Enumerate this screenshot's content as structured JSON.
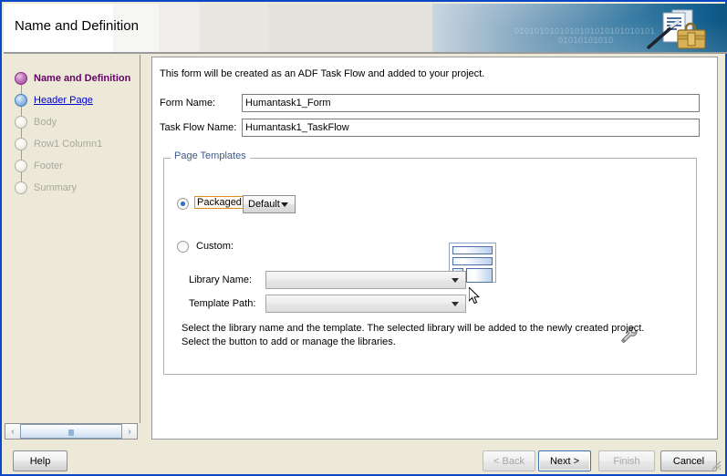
{
  "window": {
    "accent_border": "#0a48c8",
    "banner_title": "Name and Definition",
    "banner_binary_1": "0101010101010101010101010101",
    "banner_binary_2": "01010101010",
    "wizard_icon": "wizard-document-wand-briefcase-icon"
  },
  "sidebar": {
    "items": [
      {
        "label": "Name and Definition",
        "state": "active"
      },
      {
        "label": "Header Page",
        "state": "link"
      },
      {
        "label": "Body",
        "state": "disabled"
      },
      {
        "label": "Row1 Column1",
        "state": "disabled"
      },
      {
        "label": "Footer",
        "state": "disabled"
      },
      {
        "label": "Summary",
        "state": "disabled"
      }
    ],
    "scrollbar": {
      "left_arrow": "‹",
      "right_arrow": "›"
    }
  },
  "main": {
    "intro": "This form will be created as an ADF Task Flow and added to your project.",
    "fields": [
      {
        "label": "Form Name:",
        "value": "Humantask1_Form"
      },
      {
        "label": "Task Flow Name:",
        "value": "Humantask1_TaskFlow"
      }
    ],
    "group": {
      "title": "Page Templates",
      "packaged": {
        "label": "Packaged:",
        "selected": true,
        "focus_color": "#e08a1e",
        "combo_value": "Default",
        "preview_icon": "page-template-preview-icon"
      },
      "custom": {
        "label": "Custom:",
        "selected": false
      },
      "library_name": {
        "label": "Library Name:",
        "value": "",
        "disabled": true
      },
      "template_path": {
        "label": "Template Path:",
        "value": "",
        "disabled": true
      },
      "manage_libraries_icon": "wrench-icon",
      "help_line_1": "Select the library name and the template.  The selected library will be added to the newly created project.",
      "help_line_2": "Select the button to add or manage the libraries."
    }
  },
  "buttons": {
    "help": "Help",
    "back": "< Back",
    "next": "Next >",
    "finish": "Finish",
    "cancel": "Cancel"
  }
}
